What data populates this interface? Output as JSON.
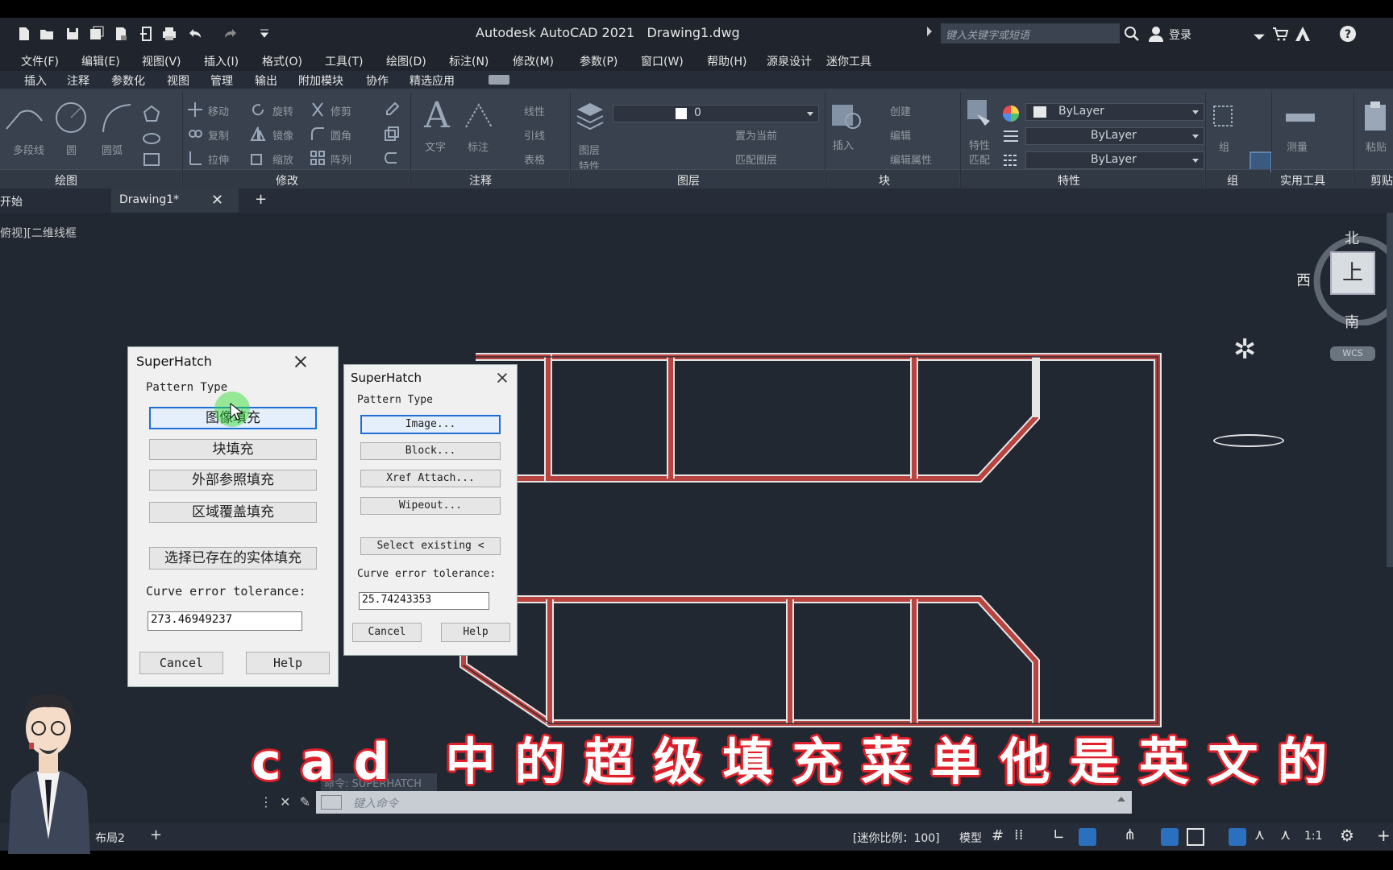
{
  "title": {
    "app_name": "Autodesk AutoCAD 2021",
    "file_name": "Drawing1.dwg",
    "search_placeholder": "键入关键字或短语",
    "login": "登录"
  },
  "menu": [
    "文件(F)",
    "编辑(E)",
    "视图(V)",
    "插入(I)",
    "格式(O)",
    "工具(T)",
    "绘图(D)",
    "标注(N)",
    "修改(M)",
    "参数(P)",
    "窗口(W)",
    "帮助(H)",
    "源泉设计",
    "迷你工具"
  ],
  "ribbon_tabs": [
    "插入",
    "注释",
    "参数化",
    "视图",
    "管理",
    "输出",
    "附加模块",
    "协作",
    "精选应用"
  ],
  "ribbon": {
    "draw": {
      "title": "绘图",
      "polyline": "多段线",
      "circle": "圆",
      "arc": "圆弧"
    },
    "modify": {
      "title": "修改",
      "move": "移动",
      "rotate": "旋转",
      "trim": "修剪",
      "copy": "复制",
      "mirror": "镜像",
      "fillet": "圆角",
      "stretch": "拉伸",
      "scale": "缩放",
      "array": "阵列"
    },
    "annotation": {
      "title": "注释",
      "text": "文字",
      "dimension": "标注",
      "linear": "线性",
      "leader": "引线",
      "table": "表格"
    },
    "layers": {
      "title": "图层",
      "layer_props": "图层",
      "layer_props2": "特性",
      "current_layer": "0",
      "set_current": "置为当前",
      "match_layer": "匹配图层"
    },
    "block": {
      "title": "块",
      "insert": "插入",
      "create": "创建",
      "edit": "编辑",
      "edit_attr": "编辑属性"
    },
    "properties": {
      "title": "特性",
      "match": "特性",
      "match2": "匹配",
      "color": "ByLayer",
      "linetype": "ByLayer",
      "lineweight": "ByLayer"
    },
    "groups": {
      "title": "组",
      "group": "组"
    },
    "utilities": {
      "title": "实用工具",
      "measure": "测量"
    },
    "clipboard": {
      "title": "剪贴",
      "paste": "粘贴"
    }
  },
  "file_tabs": {
    "start": "开始",
    "drawing": "Drawing1*"
  },
  "viewport_label": "俯视][二维线框",
  "viewcube": {
    "north": "北",
    "south": "南",
    "west": "西",
    "top": "上",
    "wcs": "WCS"
  },
  "dialog_cn": {
    "title": "SuperHatch",
    "pattern_type": "Pattern Type",
    "image": "图像填充",
    "block": "块填充",
    "xref": "外部参照填充",
    "wipeout": "区域覆盖填充",
    "select_existing": "选择已存在的实体填充",
    "tolerance_label": "Curve error tolerance:",
    "tolerance_value": "273.46949237",
    "cancel": "Cancel",
    "help": "Help"
  },
  "dialog_en": {
    "title": "SuperHatch",
    "pattern_type": "Pattern Type",
    "image": "Image...",
    "block": "Block...",
    "xref": "Xref Attach...",
    "wipeout": "Wipeout...",
    "select_existing": "Select existing <",
    "tolerance_label": "Curve error tolerance:",
    "tolerance_value": "25.74243353",
    "cancel": "Cancel",
    "help": "Help"
  },
  "command": {
    "history": "命令: SUPERHATCH",
    "placeholder": "键入命令"
  },
  "status": {
    "layout2": "布局2",
    "scale": "[迷你比例：100]",
    "model": "模型",
    "ratio": "1:1"
  },
  "subtitle": "cad 中的超级填充菜单他是英文的",
  "colors": {
    "accent": "#1e6fd9",
    "subtitle_outline": "#e0202a",
    "wall": "#b8433f"
  }
}
